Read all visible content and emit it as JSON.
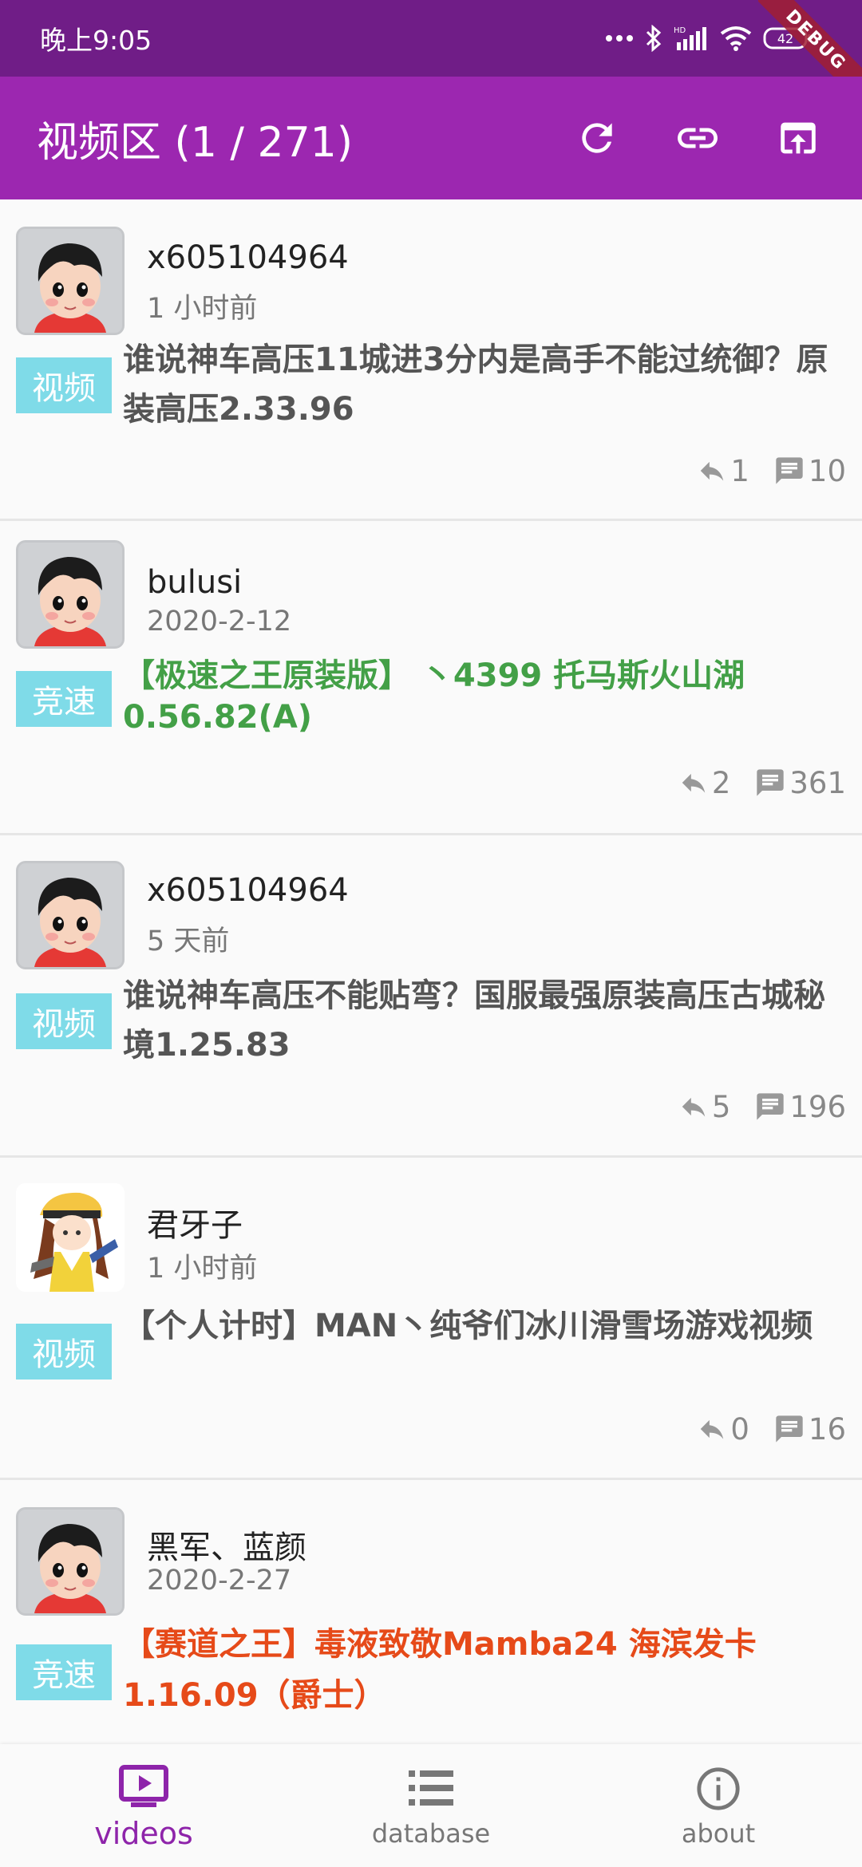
{
  "status_bar": {
    "time": "晚上9:05",
    "battery": "42",
    "debug_label": "DEBUG"
  },
  "app_bar": {
    "title": "视频区 (1 / 271)"
  },
  "posts": [
    {
      "username": "x605104964",
      "time": "1 小时前",
      "tag": "视频",
      "title": "谁说神车高压11城进3分内是高手不能过统御？原装高压2.33.96",
      "title_color": "default",
      "replies": "1",
      "comments": "10",
      "avatar": "cartoon-avatar"
    },
    {
      "username": "bulusi",
      "time": "2020-2-12",
      "tag": "竞速",
      "title": "【极速之王原装版】 丶4399  托马斯火山湖0.56.82(A)",
      "title_color": "green",
      "replies": "2",
      "comments": "361",
      "avatar": "cartoon-avatar"
    },
    {
      "username": "x605104964",
      "time": "5 天前",
      "tag": "视频",
      "title": "谁说神车高压不能贴弯？国服最强原装高压古城秘境1.25.83",
      "title_color": "default",
      "replies": "5",
      "comments": "196",
      "avatar": "cartoon-avatar"
    },
    {
      "username": "君牙子",
      "time": "1 小时前",
      "tag": "视频",
      "title": "【个人计时】MAN丶纯爷们冰川滑雪场游戏视频",
      "title_color": "default",
      "replies": "0",
      "comments": "16",
      "avatar": "anime-girl-avatar"
    },
    {
      "username": "黑军、蓝颜",
      "time": "2020-2-27",
      "tag": "竞速",
      "title": "【赛道之王】毒液致敬Mamba24 海滨发卡1.16.09（爵士）",
      "title_color": "red",
      "replies": "",
      "comments": "",
      "avatar": "cartoon-avatar"
    }
  ],
  "bottom_nav": [
    {
      "label": "videos",
      "icon": "video-icon",
      "active": true
    },
    {
      "label": "database",
      "icon": "list-icon",
      "active": false
    },
    {
      "label": "about",
      "icon": "info-icon",
      "active": false
    }
  ],
  "colors": {
    "status_bar": "#701d87",
    "app_bar": "#9c27b0",
    "tag": "#7fdbe8",
    "green_title": "#43a047",
    "red_title": "#e64a19",
    "active_nav": "#8e24aa"
  }
}
